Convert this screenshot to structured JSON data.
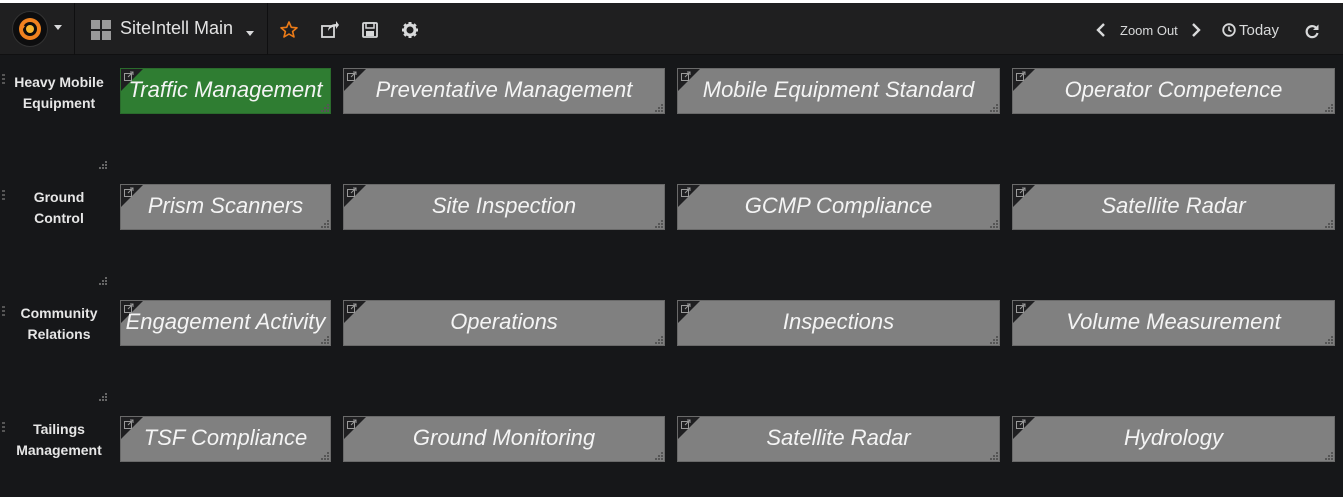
{
  "header": {
    "dashboard_title": "SiteIntell Main",
    "zoom_out_label": "Zoom Out",
    "time_label": "Today",
    "icons": [
      "grafana-logo-icon",
      "dashboard-grid-icon",
      "star-icon",
      "share-icon",
      "save-icon",
      "settings-icon",
      "chevron-left-icon",
      "chevron-right-icon",
      "clock-icon",
      "refresh-icon"
    ],
    "star_color": "#eb7b18"
  },
  "rows": [
    {
      "label": "Heavy Mobile Equipment",
      "panels": [
        {
          "title": "Traffic Management",
          "active": true
        },
        {
          "title": "Preventative Management",
          "active": false
        },
        {
          "title": "Mobile Equipment Standard",
          "active": false
        },
        {
          "title": "Operator Competence",
          "active": false
        }
      ]
    },
    {
      "label": "Ground Control",
      "panels": [
        {
          "title": "Prism Scanners",
          "active": false
        },
        {
          "title": "Site Inspection",
          "active": false
        },
        {
          "title": "GCMP Compliance",
          "active": false
        },
        {
          "title": "Satellite Radar",
          "active": false
        }
      ]
    },
    {
      "label": "Community Relations",
      "panels": [
        {
          "title": "Engagement Activity",
          "active": false
        },
        {
          "title": "Operations",
          "active": false
        },
        {
          "title": "Inspections",
          "active": false
        },
        {
          "title": "Volume Measurement",
          "active": false
        }
      ]
    },
    {
      "label": "Tailings Management",
      "panels": [
        {
          "title": "TSF Compliance",
          "active": false
        },
        {
          "title": "Ground Monitoring",
          "active": false
        },
        {
          "title": "Satellite Radar",
          "active": false
        },
        {
          "title": "Hydrology",
          "active": false
        }
      ]
    }
  ],
  "colors": {
    "active_panel": "#2f7d32",
    "panel": "#808080",
    "background": "#161719"
  }
}
